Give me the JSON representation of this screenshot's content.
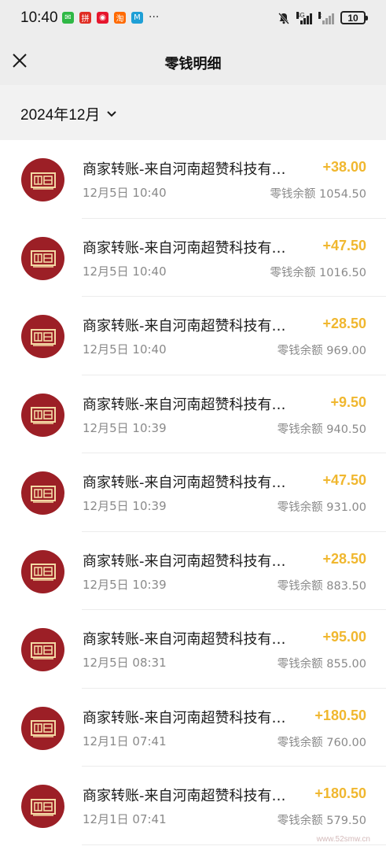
{
  "status_bar": {
    "time": "10:40",
    "notif_icons": [
      {
        "name": "wechat-icon",
        "glyph": "✉",
        "color": "#2fb845"
      },
      {
        "name": "pinduoduo-icon",
        "glyph": "拼",
        "color": "#e02e24"
      },
      {
        "name": "weibo-icon",
        "glyph": "◉",
        "color": "#e6162d"
      },
      {
        "name": "taobao-icon",
        "glyph": "淘",
        "color": "#ff6a00"
      },
      {
        "name": "meituan-icon",
        "glyph": "M",
        "color": "#1e9fd6"
      }
    ],
    "more": "···",
    "net_label_1": "4G",
    "net_label_2": "x",
    "battery": "10"
  },
  "nav": {
    "title": "零钱明细"
  },
  "filter": {
    "month": "2024年12月"
  },
  "transactions": [
    {
      "title": "商家转账-来自河南超赞科技有限公司",
      "time": "12月5日 10:40",
      "amount": "+38.00",
      "balance": "零钱余额 1054.50"
    },
    {
      "title": "商家转账-来自河南超赞科技有限公司",
      "time": "12月5日 10:40",
      "amount": "+47.50",
      "balance": "零钱余额 1016.50"
    },
    {
      "title": "商家转账-来自河南超赞科技有限公司",
      "time": "12月5日 10:40",
      "amount": "+28.50",
      "balance": "零钱余额 969.00"
    },
    {
      "title": "商家转账-来自河南超赞科技有限公司",
      "time": "12月5日 10:39",
      "amount": "+9.50",
      "balance": "零钱余额 940.50"
    },
    {
      "title": "商家转账-来自河南超赞科技有限公司",
      "time": "12月5日 10:39",
      "amount": "+47.50",
      "balance": "零钱余额 931.00"
    },
    {
      "title": "商家转账-来自河南超赞科技有限公司",
      "time": "12月5日 10:39",
      "amount": "+28.50",
      "balance": "零钱余额 883.50"
    },
    {
      "title": "商家转账-来自河南超赞科技有限公司",
      "time": "12月5日 08:31",
      "amount": "+95.00",
      "balance": "零钱余额 855.00"
    },
    {
      "title": "商家转账-来自河南超赞科技有限公司",
      "time": "12月1日 07:41",
      "amount": "+180.50",
      "balance": "零钱余额 760.00"
    },
    {
      "title": "商家转账-来自河南超赞科技有限公司",
      "time": "12月1日 07:41",
      "amount": "+180.50",
      "balance": "零钱余额 579.50"
    }
  ],
  "watermark": "www.52smw.cn",
  "colors": {
    "amount": "#f0b72f",
    "avatar_bg": "#9c1f26",
    "header_bg": "#ededed"
  }
}
